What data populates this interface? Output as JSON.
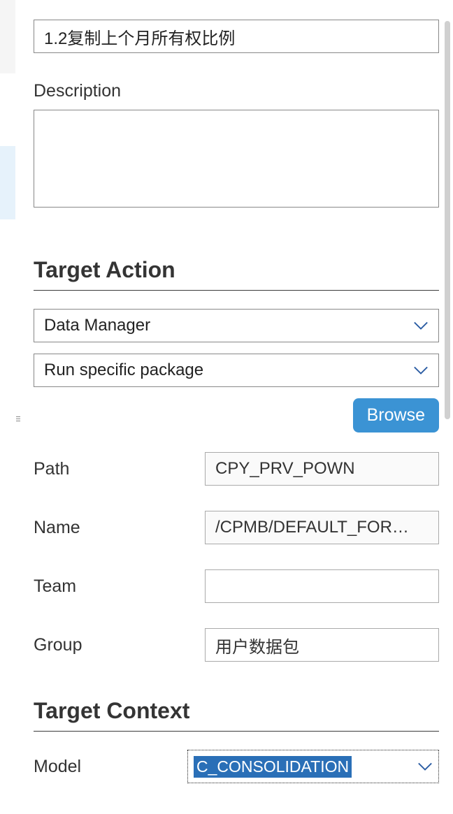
{
  "title_input": {
    "value": "1.2复制上个月所有权比例"
  },
  "description": {
    "label": "Description",
    "value": ""
  },
  "target_action": {
    "heading": "Target Action",
    "select1": "Data Manager",
    "select2": "Run specific package",
    "browse_label": "Browse",
    "fields": {
      "path": {
        "label": "Path",
        "value": "CPY_PRV_POWN"
      },
      "name": {
        "label": "Name",
        "value": "/CPMB/DEFAULT_FOR…"
      },
      "team": {
        "label": "Team",
        "value": ""
      },
      "group": {
        "label": "Group",
        "value": "用户数据包"
      }
    }
  },
  "target_context": {
    "heading": "Target Context",
    "model": {
      "label": "Model",
      "value": "C_CONSOLIDATION"
    }
  }
}
